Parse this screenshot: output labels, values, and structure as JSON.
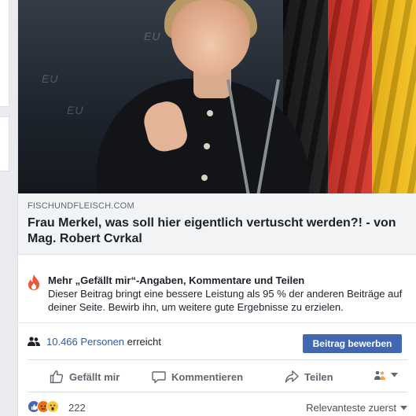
{
  "link_preview": {
    "domain": "FISCHUNDFLEISCH.COM",
    "title": "Frau Merkel, was soll hier eigentlich vertuscht werden?! - von Mag. Robert Cvrkal"
  },
  "boost_notice": {
    "heading": "Mehr „Gefällt mir“-Angaben, Kommentare und Teilen",
    "body": "Dieser Beitrag bringt eine bessere Leistung als 95 % der anderen Beiträge auf deiner Seite. Bewirb ihn, um weitere gute Ergebnisse zu erzielen."
  },
  "reach": {
    "count_label": "10.466 Personen",
    "suffix": "erreicht",
    "boost_button": "Beitrag bewerben"
  },
  "actions": {
    "like": "Gefällt mir",
    "comment": "Kommentieren",
    "share": "Teilen"
  },
  "reactions": {
    "count": "222",
    "sort_label": "Relevanteste zuerst"
  },
  "icons": {
    "flame": "flame-icon",
    "people": "people-icon",
    "like": "thumbs-up-icon",
    "comment": "speech-bubble-icon",
    "share": "share-arrow-icon",
    "audience": "friends-icon",
    "dropdown": "chevron-down-icon"
  },
  "colors": {
    "link": "#365899",
    "button": "#4267b2",
    "flame": "#e9573f"
  }
}
